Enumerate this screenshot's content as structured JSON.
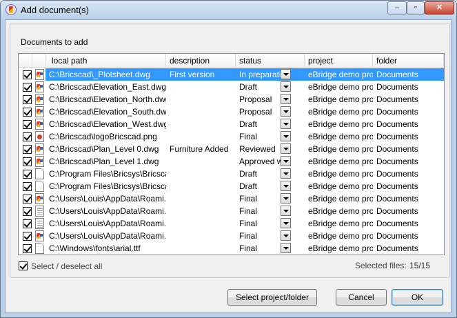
{
  "window": {
    "title": "Add document(s)",
    "controls": {
      "minimize": "–",
      "maximize": "▫",
      "close": "✕"
    }
  },
  "group": {
    "label": "Documents to add"
  },
  "table": {
    "columns": [
      "local path",
      "description",
      "status",
      "project",
      "folder"
    ],
    "rows": [
      {
        "path": "C:\\Bricscad\\_Plotsheet.dwg",
        "description": "First version",
        "status": "In preparation",
        "project": "eBridge demo pro...",
        "folder": "Documents",
        "icon": "dwg-icon",
        "checked": true,
        "selected": true
      },
      {
        "path": "C:\\Bricscad\\Elevation_East.dwg",
        "description": "",
        "status": "Draft",
        "project": "eBridge demo pro...",
        "folder": "Documents",
        "icon": "dwg-icon",
        "checked": true
      },
      {
        "path": "C:\\Bricscad\\Elevation_North.dwg",
        "description": "",
        "status": "Proposal",
        "project": "eBridge demo pro...",
        "folder": "Documents",
        "icon": "dwg-icon",
        "checked": true
      },
      {
        "path": "C:\\Bricscad\\Elevation_South.dwg",
        "description": "",
        "status": "Proposal",
        "project": "eBridge demo pro...",
        "folder": "Documents",
        "icon": "dwg-icon",
        "checked": true
      },
      {
        "path": "C:\\Bricscad\\Elevation_West.dwg",
        "description": "",
        "status": "Draft",
        "project": "eBridge demo pro...",
        "folder": "Documents",
        "icon": "dwg-icon",
        "checked": true
      },
      {
        "path": "C:\\Bricscad\\logoBricscad.png",
        "description": "",
        "status": "Final",
        "project": "eBridge demo pro...",
        "folder": "Documents",
        "icon": "png-icon",
        "checked": true
      },
      {
        "path": "C:\\Bricscad\\Plan_Level 0.dwg",
        "description": "Furniture Added",
        "status": "Reviewed",
        "project": "eBridge demo pro...",
        "folder": "Documents",
        "icon": "dwg-icon",
        "checked": true
      },
      {
        "path": "C:\\Bricscad\\Plan_Level 1.dwg",
        "description": "",
        "status": "Approved w r...",
        "project": "eBridge demo pro...",
        "folder": "Documents",
        "icon": "dwg-icon",
        "checked": true
      },
      {
        "path": "C:\\Program Files\\Bricsys\\Bricsca...",
        "description": "",
        "status": "Draft",
        "project": "eBridge demo pro...",
        "folder": "Documents",
        "icon": "blank-file-icon",
        "checked": true
      },
      {
        "path": "C:\\Program Files\\Bricsys\\Bricsca...",
        "description": "",
        "status": "Draft",
        "project": "eBridge demo pro...",
        "folder": "Documents",
        "icon": "blank-file-icon",
        "checked": true
      },
      {
        "path": "C:\\Users\\Louis\\AppData\\Roami...",
        "description": "",
        "status": "Final",
        "project": "eBridge demo pro...",
        "folder": "Documents",
        "icon": "dwg-icon",
        "checked": true
      },
      {
        "path": "C:\\Users\\Louis\\AppData\\Roami...",
        "description": "",
        "status": "Final",
        "project": "eBridge demo pro...",
        "folder": "Documents",
        "icon": "text-file-icon",
        "checked": true
      },
      {
        "path": "C:\\Users\\Louis\\AppData\\Roami...",
        "description": "",
        "status": "Final",
        "project": "eBridge demo pro...",
        "folder": "Documents",
        "icon": "text-file-icon",
        "checked": true
      },
      {
        "path": "C:\\Users\\Louis\\AppData\\Roami...",
        "description": "",
        "status": "Final",
        "project": "eBridge demo pro...",
        "folder": "Documents",
        "icon": "dwg-icon",
        "checked": true
      },
      {
        "path": "C:\\Windows\\fonts\\arial.ttf",
        "description": "",
        "status": "Final",
        "project": "eBridge demo pro...",
        "folder": "Documents",
        "icon": "blank-file-icon",
        "checked": true
      }
    ]
  },
  "footer": {
    "select_all_label": "Select / deselect all",
    "selected_files_label": "Selected files:",
    "selected_files_value": "15/15"
  },
  "buttons": {
    "select_project": "Select project/folder",
    "cancel": "Cancel",
    "ok": "OK"
  },
  "colors": {
    "selection": "#3399ff",
    "window_frame": "#b9d1ea"
  }
}
